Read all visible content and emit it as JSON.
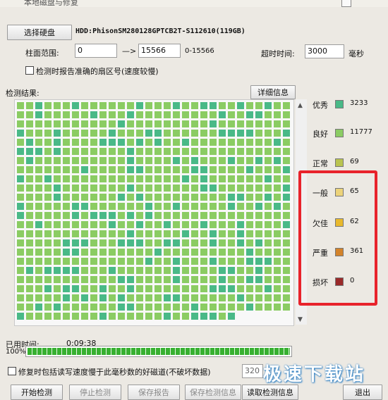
{
  "window": {
    "title": "本地磁盘与修复"
  },
  "drive_select": {
    "button_label": "选择硬盘",
    "drive_name": "HDD:PhisonSM280128GPTCB2T-S112610(119GB)"
  },
  "range": {
    "label": "柱面范围:",
    "start": "0",
    "arrow": "—>",
    "end": "15566",
    "hint": "0-15566"
  },
  "timeout": {
    "label": "超时时间:",
    "value": "3000",
    "unit": "毫秒"
  },
  "options": {
    "report_sector_label": "检测时报告准确的扇区号(速度较慢)",
    "repair_label": "修复时包括读写速度慢于此毫秒数的好磁道(不破坏数据)",
    "repair_value": "320"
  },
  "results": {
    "label": "检测结果:",
    "detail_button": "详细信息"
  },
  "legend": [
    {
      "label": "优秀",
      "count": "3233",
      "color": "#49b987"
    },
    {
      "label": "良好",
      "count": "11777",
      "color": "#8bcc63"
    },
    {
      "label": "正常",
      "count": "69",
      "color": "#b9c34f"
    },
    {
      "label": "一般",
      "count": "65",
      "color": "#ecd37a"
    },
    {
      "label": "欠佳",
      "count": "62",
      "color": "#e8b92d"
    },
    {
      "label": "严重",
      "count": "361",
      "color": "#d3832a"
    },
    {
      "label": "损坏",
      "count": "0",
      "color": "#9a2a2a"
    }
  ],
  "status": {
    "elapsed_label": "已用时间:",
    "elapsed": "0:09:38",
    "percent": "100%",
    "progress": 1.0
  },
  "bottom_buttons": {
    "btn1": "开始检测",
    "btn2": "停止检测",
    "btn3": "保存报告",
    "btn4": "保存检测信息",
    "btn5": "读取检测信息",
    "btn6": "退出"
  },
  "watermark": {
    "text": "极速下载站"
  },
  "colors": {
    "excellent": "#49b987",
    "good": "#8bcc63",
    "highlight": "#e8232b",
    "progress": "#37b030"
  }
}
